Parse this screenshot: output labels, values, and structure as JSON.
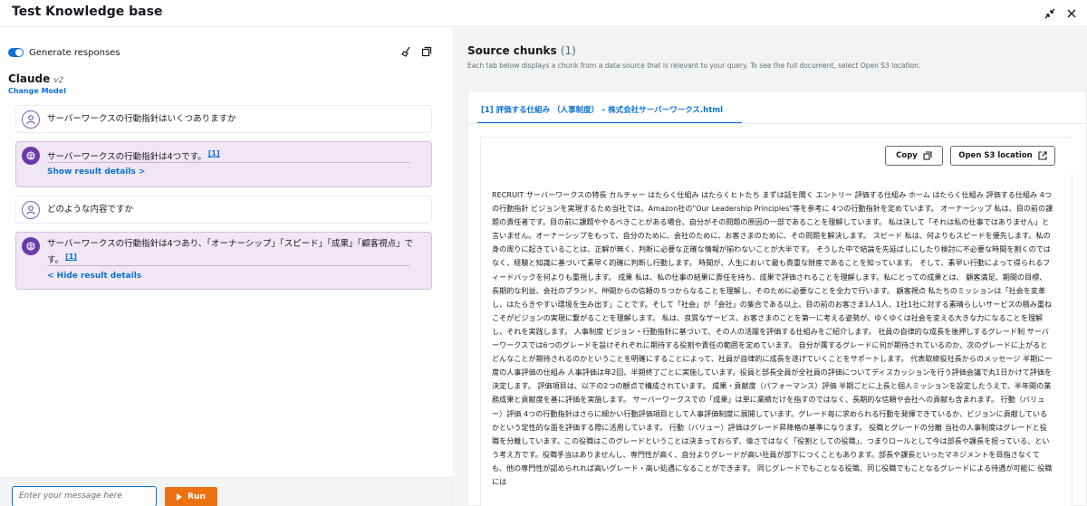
{
  "window": {
    "title": "Test Knowledge base",
    "collapse_icon": "collapse-arrows-icon",
    "close_icon": "close-icon"
  },
  "left": {
    "toggle_label": "Generate responses",
    "toggle_on": true,
    "model_name": "Claude",
    "model_version": "v2",
    "change_model": "Change Model",
    "messages": [
      {
        "role": "user",
        "text": "サーバーワークスの行動指針はいくつありますか"
      },
      {
        "role": "assistant",
        "text": "サーバーワークスの行動指針は4つです。",
        "citation": "[1]",
        "link": "Show result details >"
      },
      {
        "role": "user",
        "text": "どのような内容ですか"
      },
      {
        "role": "assistant",
        "text": "サーバーワークスの行動指針は4つあり、「オーナーシップ」「スピード」「成果」「顧客視点」で",
        "text2": "す。",
        "citation": "[1]",
        "link": "< Hide result details"
      }
    ],
    "input_placeholder": "Enter your message here",
    "run_label": "Run"
  },
  "right": {
    "title": "Source chunks",
    "count": "(1)",
    "description": "Each tab below displays a chunk from a data source that is relevant to your query. To see the full document, select Open S3 location.",
    "tab_label": "[1] 評価する仕組み （人事制度） – 株式会社サーバーワークス.html",
    "copy_label": "Copy",
    "open_s3_label": "Open S3 location",
    "chunk_text": "RECRUIT サーバーワークスの特長 カルチャー はたらく仕組み はたらくヒトたち まずは話を聞く エントリー 評価する仕組み ホーム はたらく仕組み 評価する仕組み 4つの行動指針 ビジョンを実現するため当社では、Amazon社の\"Our Leadership Principles\"等を参考に 4つの行動指針を定めています。 オーナーシップ 私は、目の前の課題の責任者です。目の前に課題ややるべきことがある場合、自分がその問題の原因の一部であることを理解しています。 私は決して「それは私の仕事ではありません」と言いません。オーナーシップをもって、自分のために、会社のために、お客さまのために、その問題を解決します。 スピード 私は、何よりもスピードを優先します。私の身の周りに起きていることは、正解が無く、判断に必要な正確な情報が揃わないことが大半です。 そうした中で結論を先延ばしにしたり検討に不必要な時間を割くのではなく、経験と知識に基づいて素早く的確に判断し行動します。 時間が、人生において最も貴重な財産であることを知っています。 そして、素早い行動によって得られるフィードバックを何よりも重視します。 成果 私は、私の仕事の結果に責任を持ち、成果で評価されることを理解します。私にとっての成果とは、 顧客満足、期間の目標、長期的な利益、会社のブランド、仲間からの信頼の５つからなることを理解し、そのために必要なことを全力で行います。 顧客視点 私たちのミッションは「社会を変革し、はたらきやすい環境を生み出す」ことです。そして「社会」が「会社」の集合である以上、目の前のお客さま1人1人、1社1社に対する素晴らしいサービスの積み重ねこそがビジョンの実現に繋がることを理解します。 私は、良質なサービス、お客さまのことを第一に考える姿勢が、ゆくゆくは社会を変える大きな力になることを理解し、それを実践します。 人事制度 ビジョン・行動指針に基づいて、その人の活躍を評価する仕組みをご紹介します。 社員の自律的な成長を後押しするグレード制 サーバーワークスでは6つのグレードを設けそれぞれに期待する役割や責任の範囲を定めています。 自分が属するグレードに何が期待されているのか、次のグレードに上がるとどんなことが期待されるのかということを明確にすることによって、社員が自律的に成長を遂げていくことをサポートします。 代表取締役社長からのメッセージ 半期に一度の人事評価の仕組み 人事評価は年2回、半期終了ごとに実施しています。役員と部長全員が全社員の評価についてディスカッションを行う評価会議で丸1日かけて評価を決定します。 評価項目は、以下の2つの観点で構成されています。 成果・貢献度（パフォーマンス）評価 半期ごとに上長と個人ミッションを設定したうえで、半年間の業務成果と貢献度を基に評価を実施します。 サーバーワークスでの「成果」は単に業績だけを指すのではなく、長期的な信頼や会社への貢献も含まれます。 行動（バリュー）評価 4つの行動指針はさらに細かい行動評価項目として人事評価制度に展開しています。グレード毎に求められる行動を発揮できているか、ビジョンに貢献しているかという定性的な面を評価する際に活用しています。 行動（バリュー）評価はグレード昇降格の基準になります。 役職とグレードの分離 当社の人事制度はグレードと役職を分離しています。この役職はこのグレードということは決まっておらず、偉さではなく「役割としての役職」、つまりロールとして今は部長や課長を担っている、という考え方です。役職手当はありませんし、専門性が高く、自分よりグレードが高い社員が部下につくこともあります。部長や課長といったマネジメントを目指さなくても、他の専門性が認められれば高いグレード・高い処遇になることができます。 同じグレードでもことなる役職、同じ役職でもことなるグレードによる待遇が可能に 役職には"
  }
}
